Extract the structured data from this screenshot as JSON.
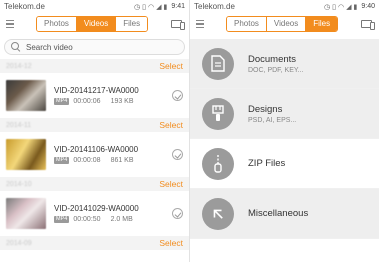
{
  "left": {
    "status": {
      "carrier": "Telekom.de",
      "time": "9:41"
    },
    "tabs": [
      "Photos",
      "Videos",
      "Files"
    ],
    "active_tab": "Videos",
    "search": {
      "placeholder": "Search video"
    },
    "groups": [
      {
        "date": "2014-12",
        "select": "Select",
        "video": {
          "name": "VID-20141217-WA0000",
          "format": "MP4",
          "duration": "00:00:06",
          "size": "193 KB"
        }
      },
      {
        "date": "2014-11",
        "select": "Select",
        "video": {
          "name": "VID-20141106-WA0000",
          "format": "MP4",
          "duration": "00:00:08",
          "size": "861 KB"
        }
      },
      {
        "date": "2014-10",
        "select": "Select",
        "video": {
          "name": "VID-20141029-WA0000",
          "format": "MP4",
          "duration": "00:00:50",
          "size": "2.0 MB"
        }
      },
      {
        "date": "2014-09",
        "select": "Select"
      }
    ]
  },
  "right": {
    "status": {
      "carrier": "Telekom.de",
      "time": "9:40"
    },
    "tabs": [
      "Photos",
      "Videos",
      "Files"
    ],
    "active_tab": "Files",
    "categories": [
      {
        "title": "Documents",
        "subtitle": "DOC, PDF, KEY...",
        "icon": "document-icon"
      },
      {
        "title": "Designs",
        "subtitle": "PSD, AI, EPS...",
        "icon": "brush-icon"
      },
      {
        "title": "ZIP Files",
        "subtitle": "",
        "icon": "zip-icon"
      },
      {
        "title": "Miscellaneous",
        "subtitle": "",
        "icon": "misc-arrow-icon"
      }
    ]
  },
  "colors": {
    "accent": "#f28c1e",
    "icon_circle": "#9b9b9b",
    "shaded_row": "#eeeeee"
  }
}
